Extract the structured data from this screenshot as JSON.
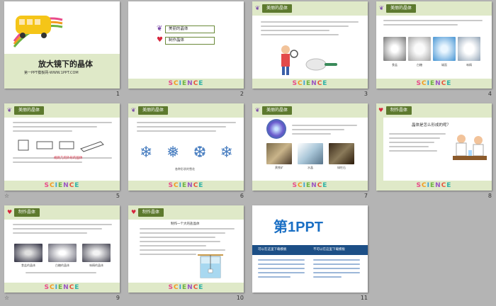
{
  "slides": [
    {
      "number": "1",
      "title": "放大镜下的晶体",
      "subtitle": "第一PPT模板网-WWW.1PPT.COM"
    },
    {
      "number": "2",
      "items": [
        "美丽的晶体",
        "制作晶体"
      ]
    },
    {
      "number": "3",
      "header": "美丽的晶体"
    },
    {
      "number": "4",
      "header": "美丽的晶体",
      "captions": [
        "食盐",
        "白糖",
        "碱面",
        "味精"
      ]
    },
    {
      "number": "5",
      "header": "美丽的晶体",
      "highlight": "规则几何外形的固体"
    },
    {
      "number": "6",
      "header": "美丽的晶体",
      "caption": "各种形状的雪花"
    },
    {
      "number": "7",
      "header": "美丽的晶体",
      "captions": [
        "黄铁矿",
        "水晶",
        "绿柱石"
      ]
    },
    {
      "number": "8",
      "header": "制作晶体",
      "question": "晶体是怎么形成的呢？"
    },
    {
      "number": "9",
      "header": "制作晶体",
      "captions": [
        "食盐的晶体",
        "白糖的晶体",
        "味精的晶体"
      ]
    },
    {
      "number": "10",
      "header": "制作晶体",
      "steps_title": "制作一个大的盐晶体"
    },
    {
      "number": "11",
      "brand": "第1PPT",
      "footer_left": "可以在这里下载模板",
      "footer_right": "不可以在这里下载模板"
    }
  ],
  "science_text": "SCIENCE",
  "transition_mark": "☆"
}
